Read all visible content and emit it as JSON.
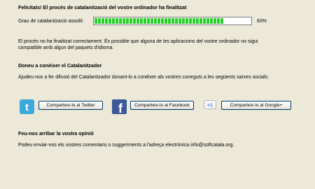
{
  "header": {
    "title": "Felicitats! El procés de catalanització del vostre ordinador ha finalitzat"
  },
  "progress": {
    "label": "Grau de catalanització assolit:",
    "value": 0.83,
    "value_text": "83%"
  },
  "status": {
    "line1": "El procés no ha finalitzat correctament. És possible que alguna de les aplicacions del vostre ordinador no sigui",
    "line2": "compatible amb algun del paquets d'idioma."
  },
  "promote": {
    "title": "Doneu a conèixer el Catalanitzador",
    "text": "Ajudeu-nos a fer difusió del Catalanitzador donant-lo a conèixer als vostres coneguts a les següents xarxes socials:"
  },
  "social": {
    "twitter": {
      "icon": "twitter-icon",
      "button": "Comparteix-lo al Twitter"
    },
    "facebook": {
      "icon": "facebook-icon",
      "button": "Comparteix-lo al Facebook"
    },
    "google": {
      "icon": "google-plus-icon",
      "badge": "+1",
      "button": "Comparteix-lo al Google+"
    }
  },
  "opinion": {
    "title": "Feu-nos arribar la vostra opinió",
    "text": "Podeu enviar-nos els vostres comentaris o suggeriments a l'adreça electrònica info@softcatala.org."
  },
  "colors": {
    "progress": "#2ad02a",
    "twitter": "#3aa9dd",
    "facebook": "#3b5998",
    "background": "#ece9d8"
  }
}
